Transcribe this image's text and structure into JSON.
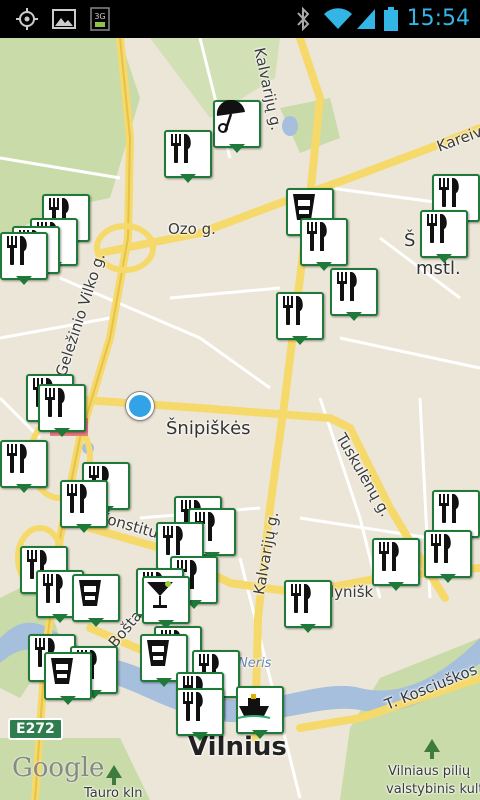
{
  "status_bar": {
    "time": "15:54",
    "icons": [
      "gps-icon",
      "image-icon",
      "3g-icon",
      "bluetooth-icon",
      "wifi-icon",
      "signal-icon",
      "battery-icon"
    ],
    "network": "3G",
    "accent": "#33b5e5"
  },
  "map": {
    "streets": {
      "kalvariju_top": "Kalvarijų g.",
      "ozo": "Ozo g.",
      "kareiv": "Kareiv",
      "gelezinio_vilko": "Geležinio Vilko g.",
      "tuskulenu": "Tuskulėnų g.",
      "kalvariju_mid": "Kalvarijų g.",
      "konstitu": "Konstitu",
      "lyniski": "lynišk",
      "bosta": "Bošta",
      "t_kosciuskos": "T. Kosciuškos",
      "neris": "Neris",
      "tauro": "Tauro kln"
    },
    "districts": {
      "snipiskes": "Šnipiškės",
      "s_top": "Š",
      "mstl": "mstl.",
      "vilnius": "Vilnius",
      "castle_line1": "Vilniaus pilių",
      "castle_line2": "valstybinis kultū"
    },
    "highway_badge": "E272",
    "attribution": "Google",
    "marker_color": "#1f7a3a",
    "location_color": "#33a3e8"
  }
}
